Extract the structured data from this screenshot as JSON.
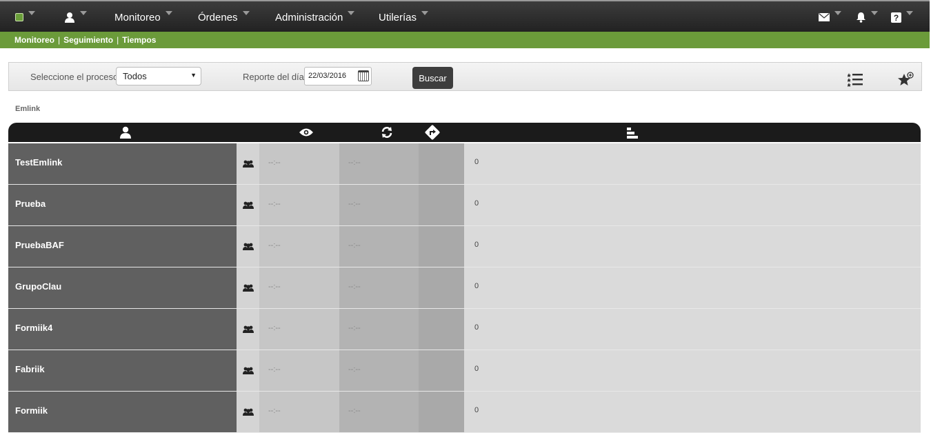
{
  "topnav": {
    "menus": [
      {
        "label": "Monitoreo"
      },
      {
        "label": "Órdenes"
      },
      {
        "label": "Administración"
      },
      {
        "label": "Utilerías"
      }
    ]
  },
  "subnav": {
    "links": [
      "Monitoreo",
      "Seguimiento",
      "Tiempos"
    ],
    "separator": "|"
  },
  "filters": {
    "process_label": "Seleccione el proceso",
    "process_value": "Todos",
    "date_label": "Reporte del día",
    "date_value": "22/03/2016",
    "search_button": "Buscar"
  },
  "group_title": "Emlink",
  "rows": [
    {
      "name": "TestEmlink",
      "t1": "--:--",
      "t2": "--:--",
      "count": "0"
    },
    {
      "name": "Prueba",
      "t1": "--:--",
      "t2": "--:--",
      "count": "0"
    },
    {
      "name": "PruebaBAF",
      "t1": "--:--",
      "t2": "--:--",
      "count": "0"
    },
    {
      "name": "GrupoClau",
      "t1": "--:--",
      "t2": "--:--",
      "count": "0"
    },
    {
      "name": "Formiik4",
      "t1": "--:--",
      "t2": "--:--",
      "count": "0"
    },
    {
      "name": "Fabriik",
      "t1": "--:--",
      "t2": "--:--",
      "count": "0"
    },
    {
      "name": "Formiik",
      "t1": "--:--",
      "t2": "--:--",
      "count": "0"
    }
  ],
  "colors": {
    "accent_green": "#6b9b3a",
    "nav_dark": "#2b2b2b"
  }
}
